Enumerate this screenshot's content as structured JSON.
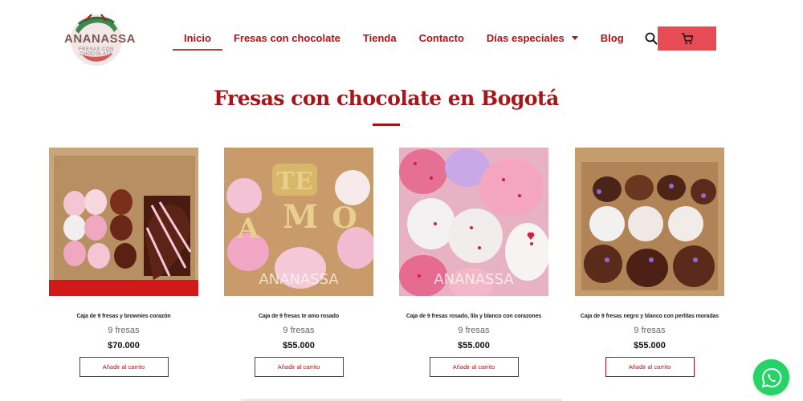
{
  "brand": {
    "name": "ANANASSA",
    "tagline": "FRESAS CON CHOCOLATE",
    "icon": "strawberry-logo"
  },
  "nav": {
    "items": [
      {
        "label": "Inicio",
        "active": true
      },
      {
        "label": "Fresas con chocolate"
      },
      {
        "label": "Tienda"
      },
      {
        "label": "Contacto"
      },
      {
        "label": "Días especiales",
        "has_dropdown": true
      },
      {
        "label": "Blog"
      }
    ],
    "search_icon": "search-icon",
    "cart_icon": "cart-icon"
  },
  "section": {
    "title": "Fresas con chocolate en Bogotá"
  },
  "products": [
    {
      "name": "Caja de 9 fresas y brownies corazón",
      "variant": "9 fresas",
      "price": "$70.000",
      "button": "Añadir al carrito"
    },
    {
      "name": "Caja de 9 fresas te amo rosado",
      "variant": "9 fresas",
      "price": "$55.000",
      "button": "Añadir al carrito"
    },
    {
      "name": "Caja de 9 fresas rosado, lila y blanco con corazones",
      "variant": "9 fresas",
      "price": "$55.000",
      "button": "Añadir al carrito"
    },
    {
      "name": "Caja de 9 fresas negro y blanco con perlitas moradas",
      "variant": "9 fresas",
      "price": "$55.000",
      "button": "Añadir al carrito"
    }
  ],
  "image_watermark": "ANANASSA",
  "letters": [
    "TE",
    "A",
    "M",
    "O"
  ],
  "colors": {
    "accent": "#b01414",
    "cart": "#e74c55",
    "whatsapp": "#25d366"
  },
  "whatsapp_icon": "whatsapp-icon"
}
